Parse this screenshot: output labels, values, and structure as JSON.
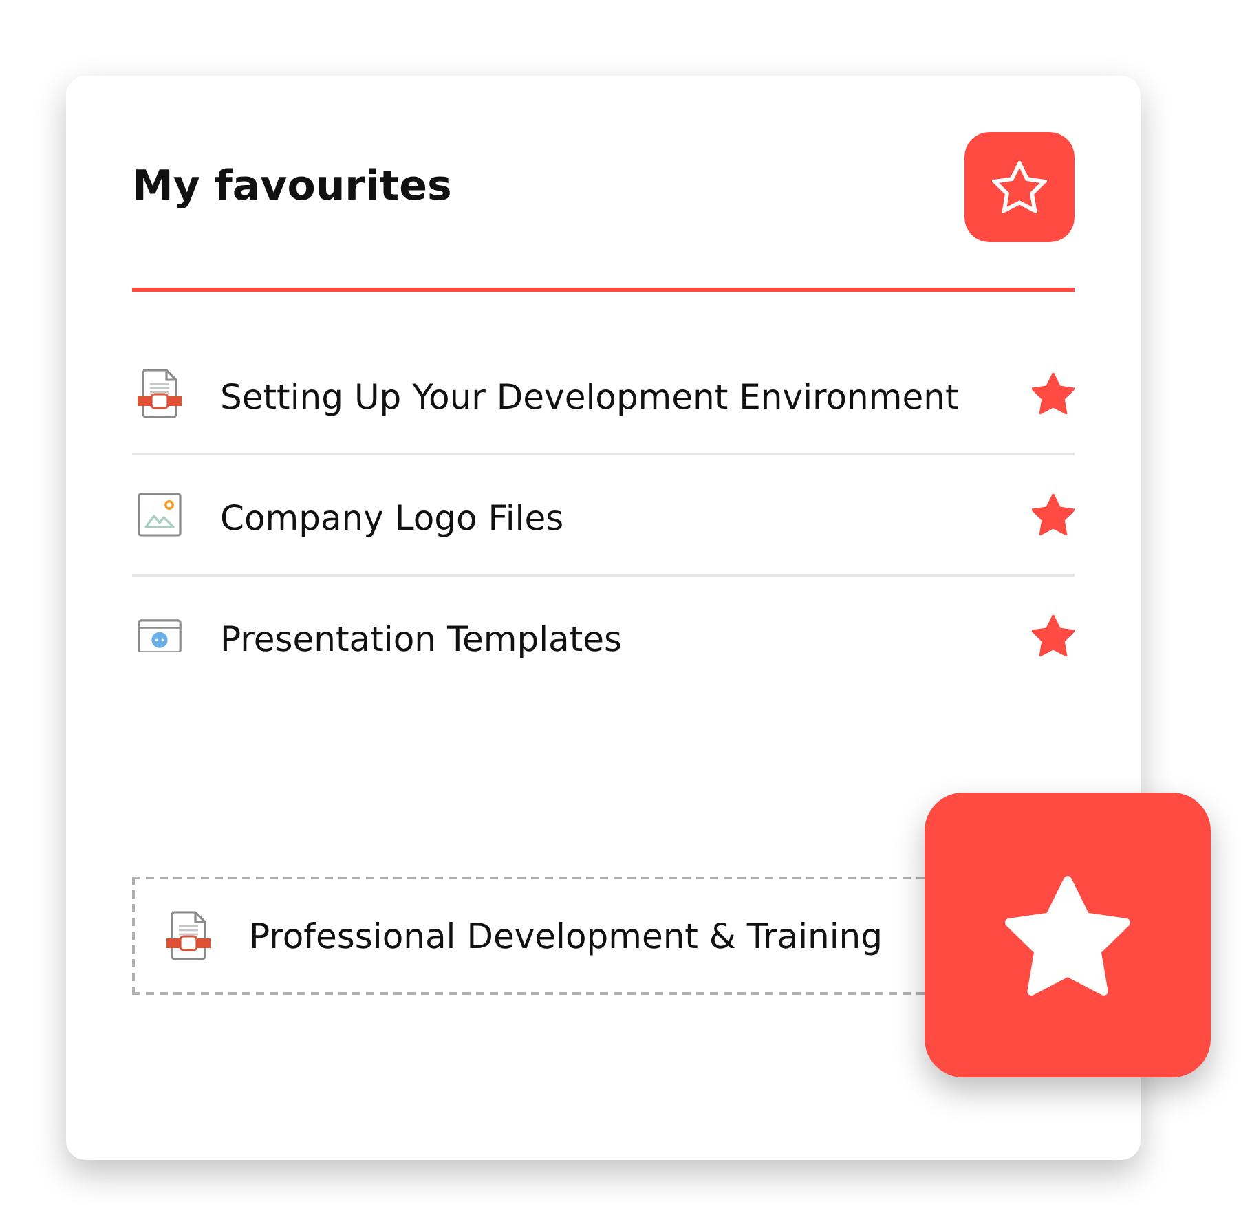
{
  "card": {
    "title": "My favourites"
  },
  "items": [
    {
      "label": "Setting Up Your Development Environment",
      "kind": "document",
      "starred": true
    },
    {
      "label": "Company Logo Files",
      "kind": "image",
      "starred": true
    },
    {
      "label": "Presentation Templates",
      "kind": "presentation",
      "starred": true
    }
  ],
  "drop_zone": {
    "label": "Professional Development & Training",
    "kind": "document"
  }
}
